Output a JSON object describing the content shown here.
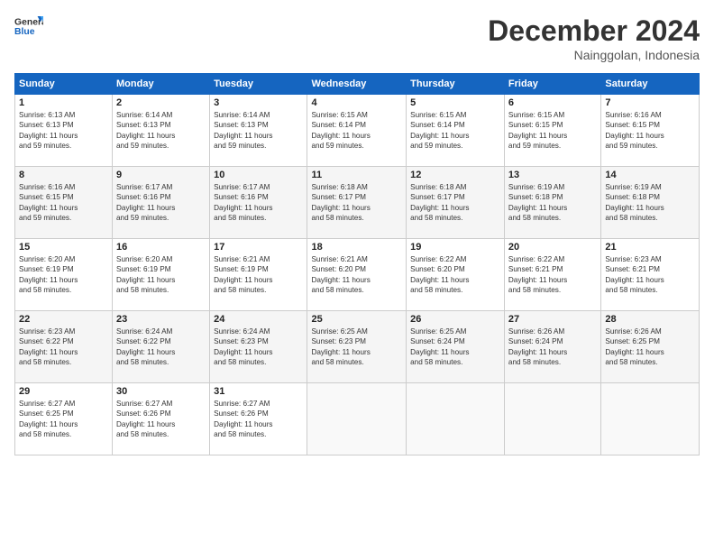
{
  "logo": {
    "general": "General",
    "blue": "Blue"
  },
  "header": {
    "month": "December 2024",
    "location": "Nainggolan, Indonesia"
  },
  "days_of_week": [
    "Sunday",
    "Monday",
    "Tuesday",
    "Wednesday",
    "Thursday",
    "Friday",
    "Saturday"
  ],
  "weeks": [
    [
      {
        "day": "1",
        "sunrise": "6:13 AM",
        "sunset": "6:13 PM",
        "daylight": "11 hours and 59 minutes."
      },
      {
        "day": "2",
        "sunrise": "6:14 AM",
        "sunset": "6:13 PM",
        "daylight": "11 hours and 59 minutes."
      },
      {
        "day": "3",
        "sunrise": "6:14 AM",
        "sunset": "6:13 PM",
        "daylight": "11 hours and 59 minutes."
      },
      {
        "day": "4",
        "sunrise": "6:15 AM",
        "sunset": "6:14 PM",
        "daylight": "11 hours and 59 minutes."
      },
      {
        "day": "5",
        "sunrise": "6:15 AM",
        "sunset": "6:14 PM",
        "daylight": "11 hours and 59 minutes."
      },
      {
        "day": "6",
        "sunrise": "6:15 AM",
        "sunset": "6:15 PM",
        "daylight": "11 hours and 59 minutes."
      },
      {
        "day": "7",
        "sunrise": "6:16 AM",
        "sunset": "6:15 PM",
        "daylight": "11 hours and 59 minutes."
      }
    ],
    [
      {
        "day": "8",
        "sunrise": "6:16 AM",
        "sunset": "6:15 PM",
        "daylight": "11 hours and 59 minutes."
      },
      {
        "day": "9",
        "sunrise": "6:17 AM",
        "sunset": "6:16 PM",
        "daylight": "11 hours and 59 minutes."
      },
      {
        "day": "10",
        "sunrise": "6:17 AM",
        "sunset": "6:16 PM",
        "daylight": "11 hours and 58 minutes."
      },
      {
        "day": "11",
        "sunrise": "6:18 AM",
        "sunset": "6:17 PM",
        "daylight": "11 hours and 58 minutes."
      },
      {
        "day": "12",
        "sunrise": "6:18 AM",
        "sunset": "6:17 PM",
        "daylight": "11 hours and 58 minutes."
      },
      {
        "day": "13",
        "sunrise": "6:19 AM",
        "sunset": "6:18 PM",
        "daylight": "11 hours and 58 minutes."
      },
      {
        "day": "14",
        "sunrise": "6:19 AM",
        "sunset": "6:18 PM",
        "daylight": "11 hours and 58 minutes."
      }
    ],
    [
      {
        "day": "15",
        "sunrise": "6:20 AM",
        "sunset": "6:19 PM",
        "daylight": "11 hours and 58 minutes."
      },
      {
        "day": "16",
        "sunrise": "6:20 AM",
        "sunset": "6:19 PM",
        "daylight": "11 hours and 58 minutes."
      },
      {
        "day": "17",
        "sunrise": "6:21 AM",
        "sunset": "6:19 PM",
        "daylight": "11 hours and 58 minutes."
      },
      {
        "day": "18",
        "sunrise": "6:21 AM",
        "sunset": "6:20 PM",
        "daylight": "11 hours and 58 minutes."
      },
      {
        "day": "19",
        "sunrise": "6:22 AM",
        "sunset": "6:20 PM",
        "daylight": "11 hours and 58 minutes."
      },
      {
        "day": "20",
        "sunrise": "6:22 AM",
        "sunset": "6:21 PM",
        "daylight": "11 hours and 58 minutes."
      },
      {
        "day": "21",
        "sunrise": "6:23 AM",
        "sunset": "6:21 PM",
        "daylight": "11 hours and 58 minutes."
      }
    ],
    [
      {
        "day": "22",
        "sunrise": "6:23 AM",
        "sunset": "6:22 PM",
        "daylight": "11 hours and 58 minutes."
      },
      {
        "day": "23",
        "sunrise": "6:24 AM",
        "sunset": "6:22 PM",
        "daylight": "11 hours and 58 minutes."
      },
      {
        "day": "24",
        "sunrise": "6:24 AM",
        "sunset": "6:23 PM",
        "daylight": "11 hours and 58 minutes."
      },
      {
        "day": "25",
        "sunrise": "6:25 AM",
        "sunset": "6:23 PM",
        "daylight": "11 hours and 58 minutes."
      },
      {
        "day": "26",
        "sunrise": "6:25 AM",
        "sunset": "6:24 PM",
        "daylight": "11 hours and 58 minutes."
      },
      {
        "day": "27",
        "sunrise": "6:26 AM",
        "sunset": "6:24 PM",
        "daylight": "11 hours and 58 minutes."
      },
      {
        "day": "28",
        "sunrise": "6:26 AM",
        "sunset": "6:25 PM",
        "daylight": "11 hours and 58 minutes."
      }
    ],
    [
      {
        "day": "29",
        "sunrise": "6:27 AM",
        "sunset": "6:25 PM",
        "daylight": "11 hours and 58 minutes."
      },
      {
        "day": "30",
        "sunrise": "6:27 AM",
        "sunset": "6:26 PM",
        "daylight": "11 hours and 58 minutes."
      },
      {
        "day": "31",
        "sunrise": "6:27 AM",
        "sunset": "6:26 PM",
        "daylight": "11 hours and 58 minutes."
      },
      null,
      null,
      null,
      null
    ]
  ],
  "labels": {
    "sunrise": "Sunrise: ",
    "sunset": "Sunset: ",
    "daylight": "Daylight: "
  }
}
